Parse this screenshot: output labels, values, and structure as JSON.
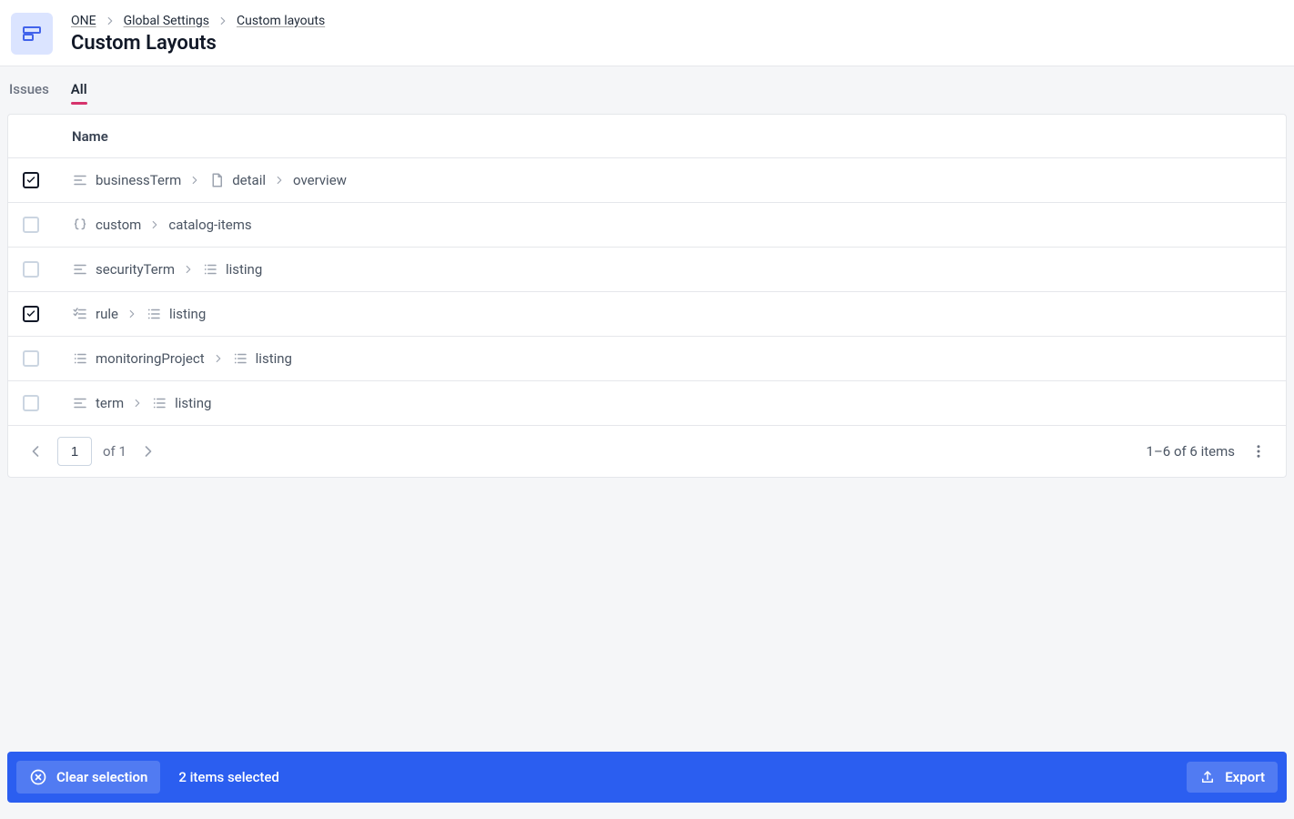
{
  "breadcrumb": {
    "items": [
      "ONE",
      "Global Settings",
      "Custom layouts"
    ]
  },
  "page_title": "Custom Layouts",
  "tabs": {
    "issues": "Issues",
    "all": "All"
  },
  "table": {
    "header_name": "Name",
    "rows": [
      {
        "checked": true,
        "segments": [
          {
            "icon": "text",
            "text": "businessTerm"
          },
          {
            "icon": "doc",
            "text": "detail"
          },
          {
            "icon": "",
            "text": "overview"
          }
        ]
      },
      {
        "checked": false,
        "segments": [
          {
            "icon": "braces",
            "text": "custom"
          },
          {
            "icon": "",
            "text": "catalog-items"
          }
        ]
      },
      {
        "checked": false,
        "segments": [
          {
            "icon": "text",
            "text": "securityTerm"
          },
          {
            "icon": "list",
            "text": "listing"
          }
        ]
      },
      {
        "checked": true,
        "segments": [
          {
            "icon": "checklist",
            "text": "rule"
          },
          {
            "icon": "list",
            "text": "listing"
          }
        ]
      },
      {
        "checked": false,
        "segments": [
          {
            "icon": "list",
            "text": "monitoringProject"
          },
          {
            "icon": "list",
            "text": "listing"
          }
        ]
      },
      {
        "checked": false,
        "segments": [
          {
            "icon": "text",
            "text": "term"
          },
          {
            "icon": "list",
            "text": "listing"
          }
        ]
      }
    ]
  },
  "pagination": {
    "page": "1",
    "of_label": "of 1",
    "count_label": "1–6 of 6 items"
  },
  "selection_bar": {
    "clear": "Clear selection",
    "count_label": "2 items selected",
    "export": "Export"
  }
}
